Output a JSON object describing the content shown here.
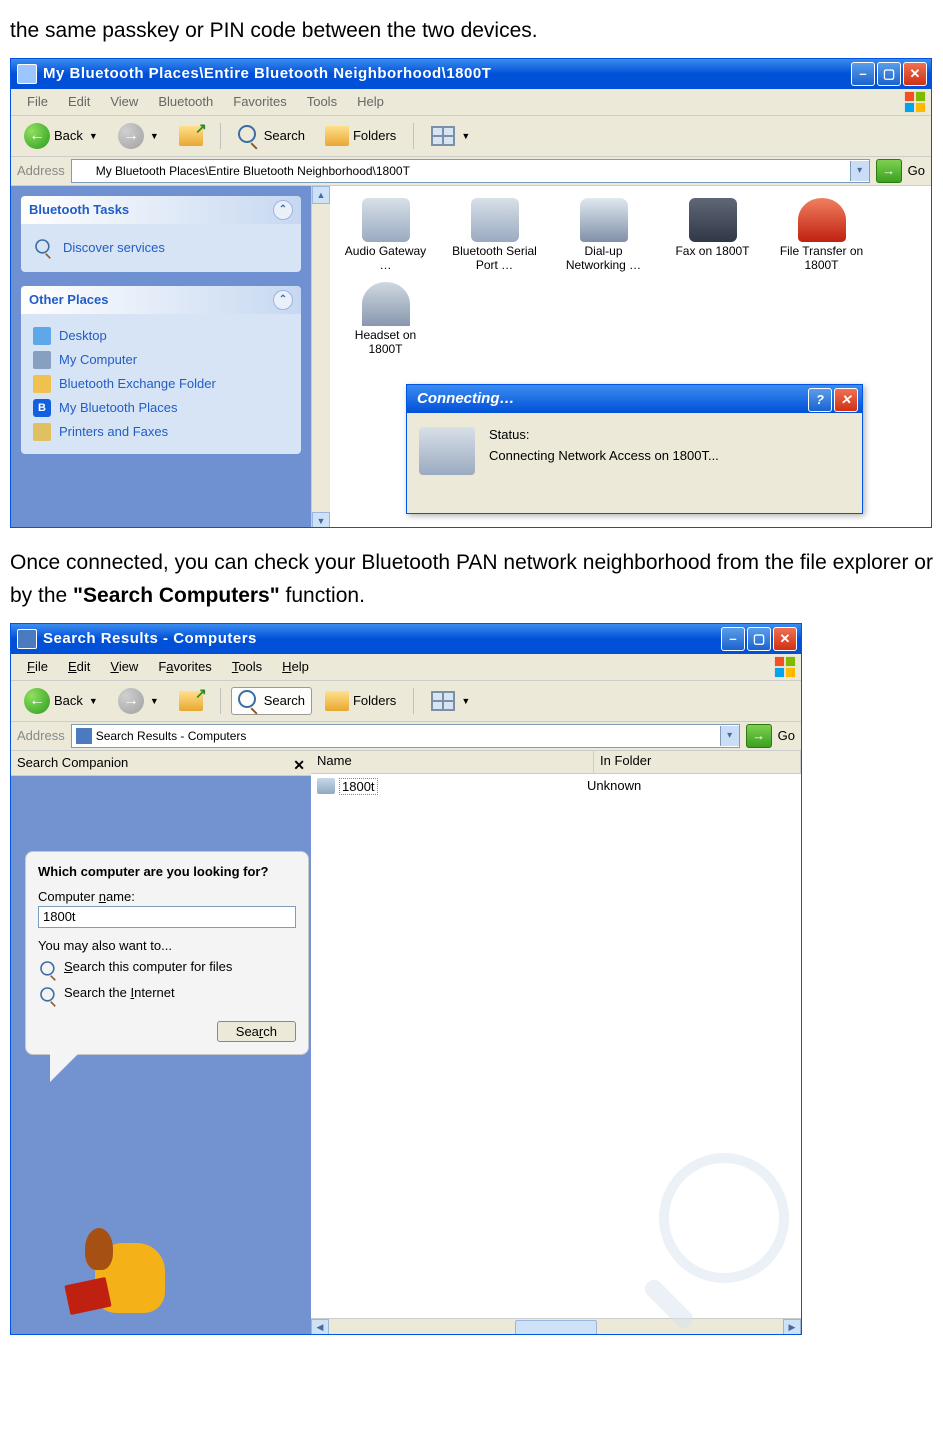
{
  "doc": {
    "intro_line": "the same passkey or PIN code between the two devices.",
    "para2_a": "Once connected, you can check your Bluetooth PAN network neighborhood from the file explorer or by the ",
    "para2_bold": "\"Search Computers\"",
    "para2_b": " function."
  },
  "window1": {
    "title": "My Bluetooth Places\\Entire Bluetooth Neighborhood\\1800T",
    "menus": [
      "File",
      "Edit",
      "View",
      "Bluetooth",
      "Favorites",
      "Tools",
      "Help"
    ],
    "toolbar": {
      "back": "Back",
      "search": "Search",
      "folders": "Folders"
    },
    "address": {
      "label": "Address",
      "value": "My Bluetooth Places\\Entire Bluetooth Neighborhood\\1800T",
      "go": "Go"
    },
    "tasks": {
      "bluetooth_tasks": {
        "title": "Bluetooth Tasks",
        "items": [
          "Discover services"
        ]
      },
      "other_places": {
        "title": "Other Places",
        "items": [
          "Desktop",
          "My Computer",
          "Bluetooth Exchange Folder",
          "My Bluetooth Places",
          "Printers and Faxes"
        ]
      }
    },
    "devices": [
      {
        "name": "Audio Gateway …"
      },
      {
        "name": "Bluetooth Serial Port …"
      },
      {
        "name": "Dial-up Networking …"
      },
      {
        "name": "Fax on 1800T"
      },
      {
        "name": "File Transfer on 1800T"
      },
      {
        "name": "Headset on 1800T"
      }
    ],
    "dialog": {
      "title": "Connecting…",
      "status_label": "Status:",
      "status_msg": "Connecting Network Access on 1800T..."
    }
  },
  "window2": {
    "title": "Search Results - Computers",
    "menus_html": [
      "File",
      "Edit",
      "View",
      "Favorites",
      "Tools",
      "Help"
    ],
    "toolbar": {
      "back": "Back",
      "search": "Search",
      "folders": "Folders"
    },
    "address": {
      "label": "Address",
      "value": "Search Results - Computers",
      "go": "Go"
    },
    "search_companion": {
      "label": "Search Companion",
      "question": "Which computer are you looking for?",
      "field_label": "Computer name:",
      "field_value": "1800t",
      "hint": "You may also want to...",
      "opt1": "Search this computer for files",
      "opt2": "Search the Internet",
      "button": "Search"
    },
    "columns": {
      "c1": "Name",
      "c2": "In Folder"
    },
    "result": {
      "name": "1800t",
      "folder": "Unknown"
    }
  }
}
